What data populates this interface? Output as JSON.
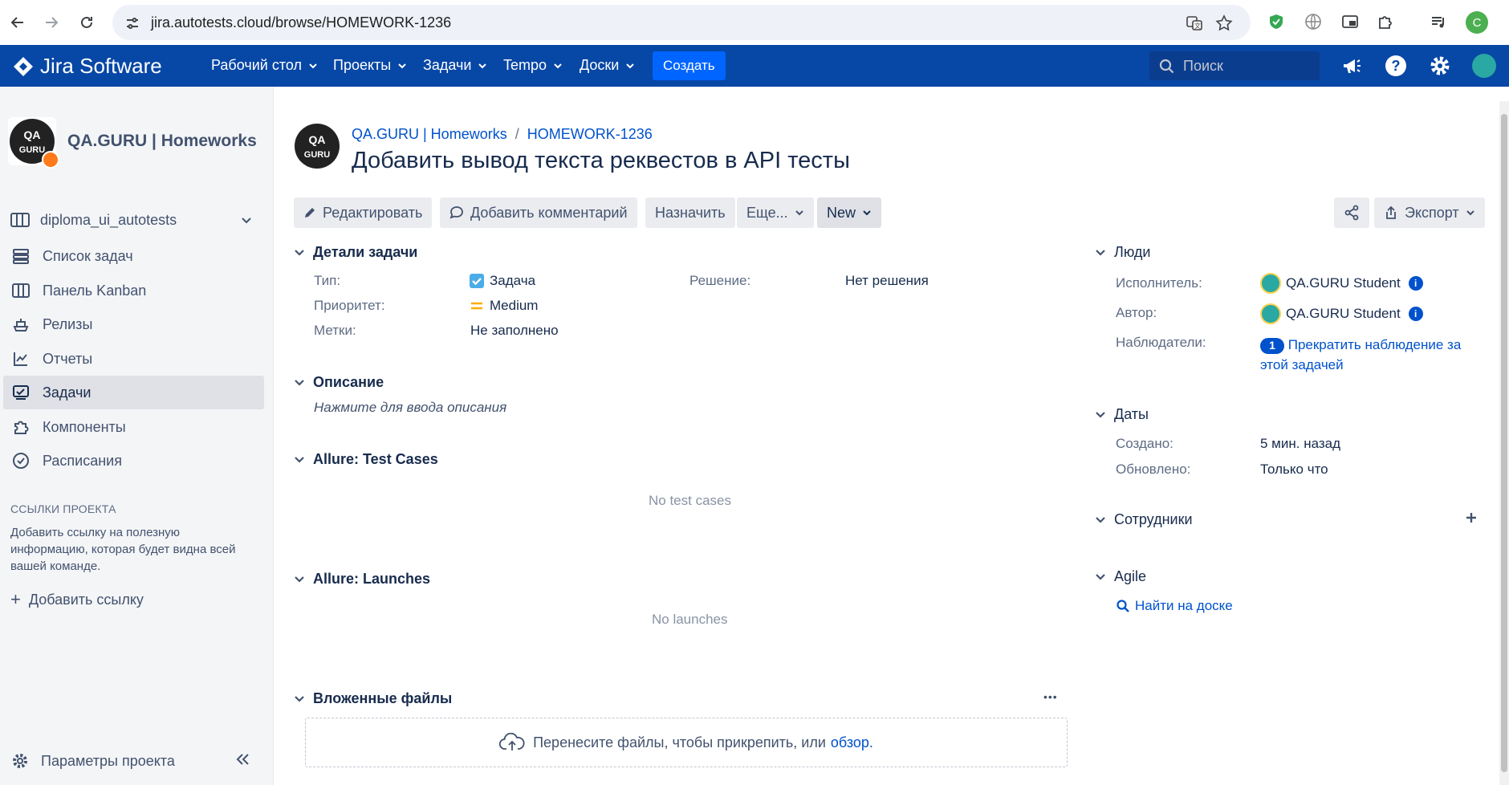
{
  "browser": {
    "url": "jira.autotests.cloud/browse/HOMEWORK-1236",
    "profile_initial": "C"
  },
  "header": {
    "logo": "Jira Software",
    "nav": [
      "Рабочий стол",
      "Проекты",
      "Задачи",
      "Tempo",
      "Доски"
    ],
    "create_label": "Создать",
    "search_placeholder": "Поиск"
  },
  "sidebar": {
    "project_name": "QA.GURU | Homeworks",
    "board": "diploma_ui_autotests",
    "items": [
      {
        "label": "Список задач",
        "icon": "backlog-icon"
      },
      {
        "label": "Панель Kanban",
        "icon": "board-icon"
      },
      {
        "label": "Релизы",
        "icon": "ship-icon"
      },
      {
        "label": "Отчеты",
        "icon": "chart-icon"
      },
      {
        "label": "Задачи",
        "icon": "issues-icon"
      },
      {
        "label": "Компоненты",
        "icon": "puzzle-icon"
      },
      {
        "label": "Расписания",
        "icon": "clock-icon"
      }
    ],
    "active_index": 4,
    "links_title": "ССЫЛКИ ПРОЕКТА",
    "links_text": "Добавить ссылку на полезную информацию, которая будет видна всей вашей команде.",
    "add_link": "Добавить ссылку",
    "settings": "Параметры проекта"
  },
  "issue": {
    "breadcrumb_project": "QA.GURU | Homeworks",
    "breadcrumb_sep": "/",
    "breadcrumb_key": "HOMEWORK-1236",
    "title": "Добавить вывод текста реквестов в API тесты"
  },
  "toolbar": {
    "edit": "Редактировать",
    "comment": "Добавить комментарий",
    "assign": "Назначить",
    "more": "Еще...",
    "status": "New",
    "export": "Экспорт"
  },
  "details": {
    "title": "Детали задачи",
    "type_label": "Тип:",
    "type_value": "Задача",
    "priority_label": "Приоритет:",
    "priority_value": "Medium",
    "labels_label": "Метки:",
    "labels_value": "Не заполнено",
    "resolution_label": "Решение:",
    "resolution_value": "Нет решения"
  },
  "description": {
    "title": "Описание",
    "placeholder": "Нажмите для ввода описания"
  },
  "allure_cases": {
    "title": "Allure: Test Cases",
    "empty": "No test cases"
  },
  "allure_launches": {
    "title": "Allure: Launches",
    "empty": "No launches"
  },
  "attachments": {
    "title": "Вложенные файлы",
    "more": "•••",
    "drop_text": "Перенесите файлы, чтобы прикрепить, или",
    "browse": "обзор."
  },
  "people": {
    "title": "Люди",
    "assignee_label": "Исполнитель:",
    "assignee": "QA.GURU Student",
    "reporter_label": "Автор:",
    "reporter": "QA.GURU Student",
    "watchers_label": "Наблюдатели:",
    "watchers_count": "1",
    "watch_stop": "Прекратить наблюдение за этой задачей"
  },
  "dates": {
    "title": "Даты",
    "created_label": "Создано:",
    "created": "5 мин. назад",
    "updated_label": "Обновлено:",
    "updated": "Только что"
  },
  "staff": {
    "title": "Сотрудники"
  },
  "agile": {
    "title": "Agile",
    "find": "Найти на доске"
  },
  "colors": {
    "header_bg": "#0747a6",
    "create_bg": "#0065ff",
    "link": "#0052cc",
    "sidebar_bg": "#f4f5f7",
    "priority_medium": "#ffab00"
  }
}
